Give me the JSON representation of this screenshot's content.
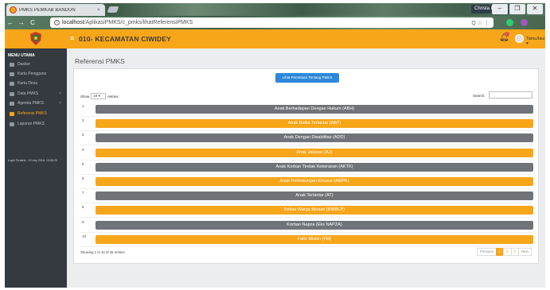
{
  "browser": {
    "tab_title": "PMKS PEMKAB BANDUN",
    "tab_close": "×",
    "user_name": "Christa Lumbert",
    "win_min": "–",
    "win_max": "❐",
    "win_close": "✕",
    "nav_back": "←",
    "nav_fwd": "→",
    "nav_reload": "C",
    "url_host": "localhost",
    "url_path": "/AplikasiPMKS/c_pmks/lihatReferensiPMKS",
    "url_tools": "Q ☆ ⋮"
  },
  "header": {
    "district": "010- KECAMATAN CIWIDEY",
    "user_menu": "Tamu/laun ▾",
    "accent_color": "#f8a619"
  },
  "sidebar": {
    "title": "MENU UTAMA",
    "items": [
      {
        "label": "Dasbor",
        "icon": "dashboard-icon",
        "has_arrow": false,
        "active": false
      },
      {
        "label": "Kartu Pengguna",
        "icon": "id-card-icon",
        "has_arrow": false,
        "active": false
      },
      {
        "label": "Kartu Desa",
        "icon": "card-icon",
        "has_arrow": false,
        "active": false
      },
      {
        "label": "Data PMKS",
        "icon": "users-icon",
        "has_arrow": true,
        "active": false
      },
      {
        "label": "Agenda PMKS",
        "icon": "calendar-icon",
        "has_arrow": true,
        "active": false
      },
      {
        "label": "Referensi PMKS",
        "icon": "book-icon",
        "has_arrow": false,
        "active": true
      },
      {
        "label": "Laporan PMKS",
        "icon": "chart-icon",
        "has_arrow": false,
        "active": false
      }
    ],
    "last_update": "Login Terakhir : 19 July 2018, 10:05:20"
  },
  "main": {
    "page_title": "Referensi PMKS",
    "info_button": "Lihat Pemetaan Tentang PMKS",
    "show_label": "Show",
    "show_value": "10",
    "entries_label": "entries",
    "search_label": "Search:",
    "rows": [
      {
        "num": "1",
        "label": "Anak Berhadapan Dengan Hukum (ABH)",
        "style": "gray"
      },
      {
        "num": "2",
        "label": "Anak Balita Terlantar (ABT)",
        "style": "orange"
      },
      {
        "num": "3",
        "label": "Anak Dengan Disabilitas (ADD)",
        "style": "gray"
      },
      {
        "num": "4",
        "label": "Anak Jalanan (AJ)",
        "style": "orange"
      },
      {
        "num": "5",
        "label": "Anak Korban Tindak Kekerasan (AKTK)",
        "style": "gray"
      },
      {
        "num": "6",
        "label": "Anak Perlindungan Khusus (AMPK)",
        "style": "orange"
      },
      {
        "num": "7",
        "label": "Anak Terlantar (AT)",
        "style": "gray"
      },
      {
        "num": "8",
        "label": "Bekas Warga Binaan (BWBLP)",
        "style": "orange"
      },
      {
        "num": "9",
        "label": "Korban Napza (Eks NAPZA)",
        "style": "gray"
      },
      {
        "num": "10",
        "label": "Fakir Miskin (FM)",
        "style": "orange"
      }
    ],
    "showing": "Showing 1 to 10 of 26 entries",
    "pager": [
      "Previous",
      "1",
      "2",
      "3",
      "Next"
    ],
    "pager_current": "1"
  }
}
